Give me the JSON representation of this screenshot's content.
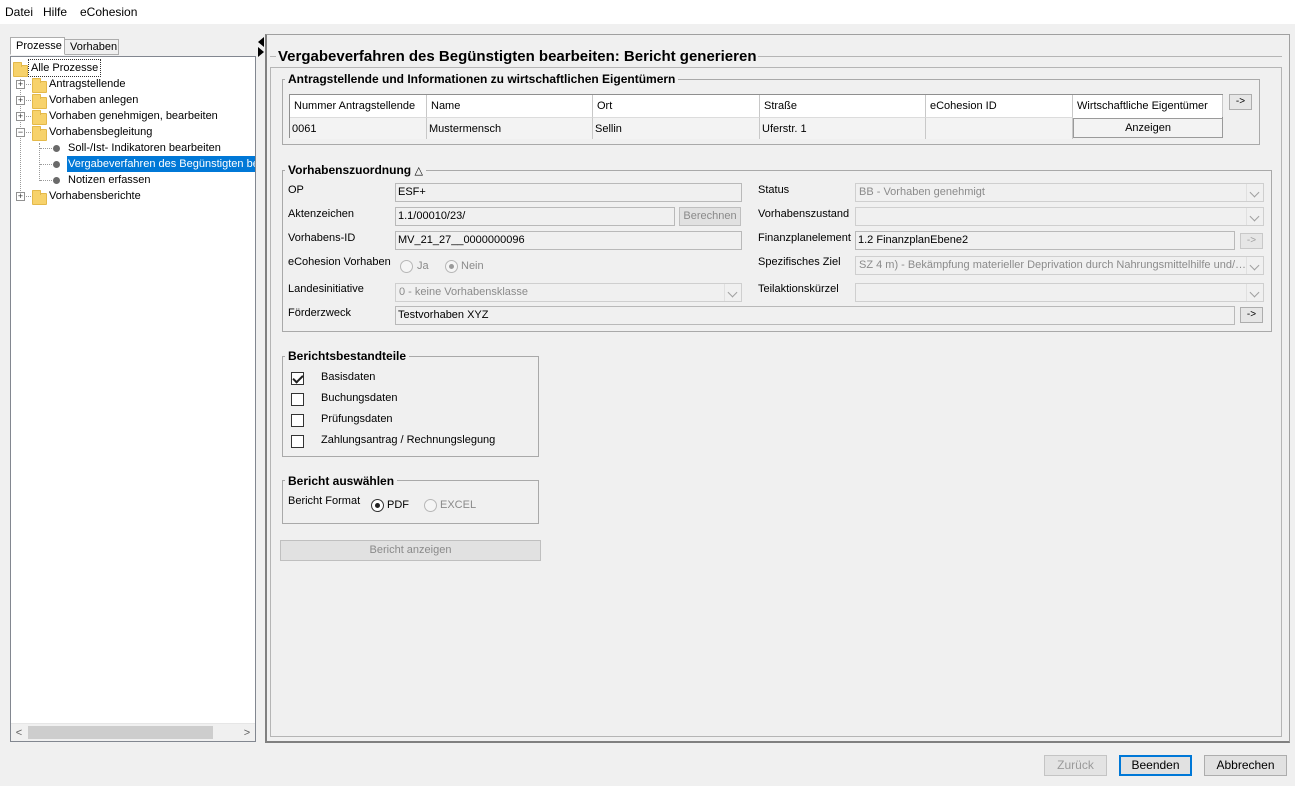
{
  "menu": [
    "Datei",
    "Hilfe",
    "eCohesion"
  ],
  "left_tabs": [
    "Prozesse",
    "Vorhaben"
  ],
  "tree": {
    "root": "Alle Prozesse",
    "items": [
      {
        "label": "Antragstellende"
      },
      {
        "label": "Vorhaben anlegen"
      },
      {
        "label": "Vorhaben genehmigen, bearbeiten"
      },
      {
        "label": "Vorhabensbegleitung"
      },
      {
        "label": "Soll-/Ist- Indikatoren bearbeiten"
      },
      {
        "label": "Vergabeverfahren des Begünstigten be"
      },
      {
        "label": "Notizen erfassen"
      },
      {
        "label": "Vorhabensberichte"
      }
    ]
  },
  "main": {
    "title": "Vergabeverfahren des Begünstigten bearbeiten: Bericht generieren"
  },
  "applicants": {
    "title": "Antragstellende und Informationen zu wirtschaftlichen Eigentümern",
    "columns": [
      "Nummer Antragstellende",
      "Name",
      "Ort",
      "Straße",
      "eCohesion ID",
      "Wirtschaftliche Eigentümer"
    ],
    "row": [
      "0061",
      "Mustermensch",
      "Sellin",
      "Uferstr. 1",
      "",
      "Anzeigen"
    ],
    "arrow_button": "->"
  },
  "assignment": {
    "title": "Vorhabenszuordnung",
    "op_label": "OP",
    "op_value": "ESF+",
    "aktenzeichen_label": "Aktenzeichen",
    "aktenzeichen_value": "1.1/00010/23/",
    "berechnen": "Berechnen",
    "vorhabens_id_label": "Vorhabens-ID",
    "vorhabens_id_value": "MV_21_27__0000000096",
    "ecohesion_label": "eCohesion Vorhaben",
    "ja": "Ja",
    "nein": "Nein",
    "landesinitiative_label": "Landesinitiative",
    "landesinitiative_value": "0 - keine Vorhabensklasse",
    "foerderzweck_label": "Förderzweck",
    "foerderzweck_value": "Testvorhaben XYZ",
    "status_label": "Status",
    "status_value": "BB - Vorhaben genehmigt",
    "zustand_label": "Vorhabenszustand",
    "zustand_value": "",
    "finanzplan_label": "Finanzplanelement",
    "finanzplan_value": "1.2 FinanzplanEbene2",
    "ziel_label": "Spezifisches Ziel",
    "ziel_value": "SZ 4 m) - Bekämpfung materieller Deprivation durch Nahrungsmittelhilfe und/…",
    "teilaktion_label": "Teilaktionskürzel",
    "teilaktion_value": "",
    "arrow": "->"
  },
  "report_parts": {
    "title": "Berichtsbestandteile",
    "items": [
      {
        "label": "Basisdaten",
        "checked": true
      },
      {
        "label": "Buchungsdaten",
        "checked": false
      },
      {
        "label": "Prüfungsdaten",
        "checked": false
      },
      {
        "label": "Zahlungsantrag / Rechnungslegung",
        "checked": false
      }
    ]
  },
  "report_select": {
    "title": "Bericht auswählen",
    "format_label": "Bericht Format",
    "pdf": "PDF",
    "excel": "EXCEL"
  },
  "show_report": "Bericht anzeigen",
  "footer": {
    "back": "Zurück",
    "finish": "Beenden",
    "cancel": "Abbrechen"
  }
}
